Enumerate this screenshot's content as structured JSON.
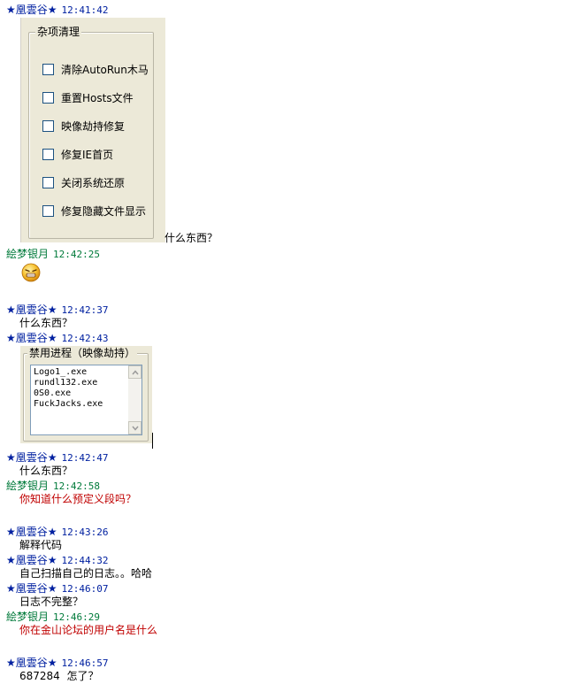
{
  "users": {
    "a": "★凰雲谷★",
    "b": "絵梦银月"
  },
  "colors": {
    "user_a": "#0020a0",
    "user_b": "#007a3a",
    "highlight_msg": "#c00000"
  },
  "messages": [
    {
      "user": "★凰雲谷★",
      "time": "12:41:42",
      "text": "什么东西？"
    },
    {
      "user": "絵梦银月",
      "time": "12:42:25",
      "icon": "grin-emoticon"
    },
    {
      "user": "★凰雲谷★",
      "time": "12:42:37",
      "text": "什么东西？"
    },
    {
      "user": "★凰雲谷★",
      "time": "12:42:43"
    },
    {
      "user": "★凰雲谷★",
      "time": "12:42:47",
      "text": "什么东西？"
    },
    {
      "user": "絵梦银月",
      "time": "12:42:58",
      "text": "你知道什么预定义段吗？"
    },
    {
      "user": "★凰雲谷★",
      "time": "12:43:26",
      "text": "解释代码"
    },
    {
      "user": "★凰雲谷★",
      "time": "12:44:32",
      "text": "自己扫描自己的日志。。哈哈"
    },
    {
      "user": "★凰雲谷★",
      "time": "12:46:07",
      "text": "日志不完整？"
    },
    {
      "user": "絵梦银月",
      "time": "12:46:29",
      "text": "你在金山论坛的用户名是什么"
    },
    {
      "user": "★凰雲谷★",
      "time": "12:46:57",
      "text": "687284  怎了？"
    }
  ],
  "panel_cleanup": {
    "title": "杂项清理",
    "options": [
      "清除AutoRun木马",
      "重置Hosts文件",
      "映像劫持修复",
      "修复IE首页",
      "关闭系统还原",
      "修复隐藏文件显示"
    ]
  },
  "panel_process": {
    "title": "禁用进程（映像劫持）",
    "items": [
      "Logo1_.exe",
      "rundl132.exe",
      "0S0.exe",
      "FuckJacks.exe"
    ]
  }
}
